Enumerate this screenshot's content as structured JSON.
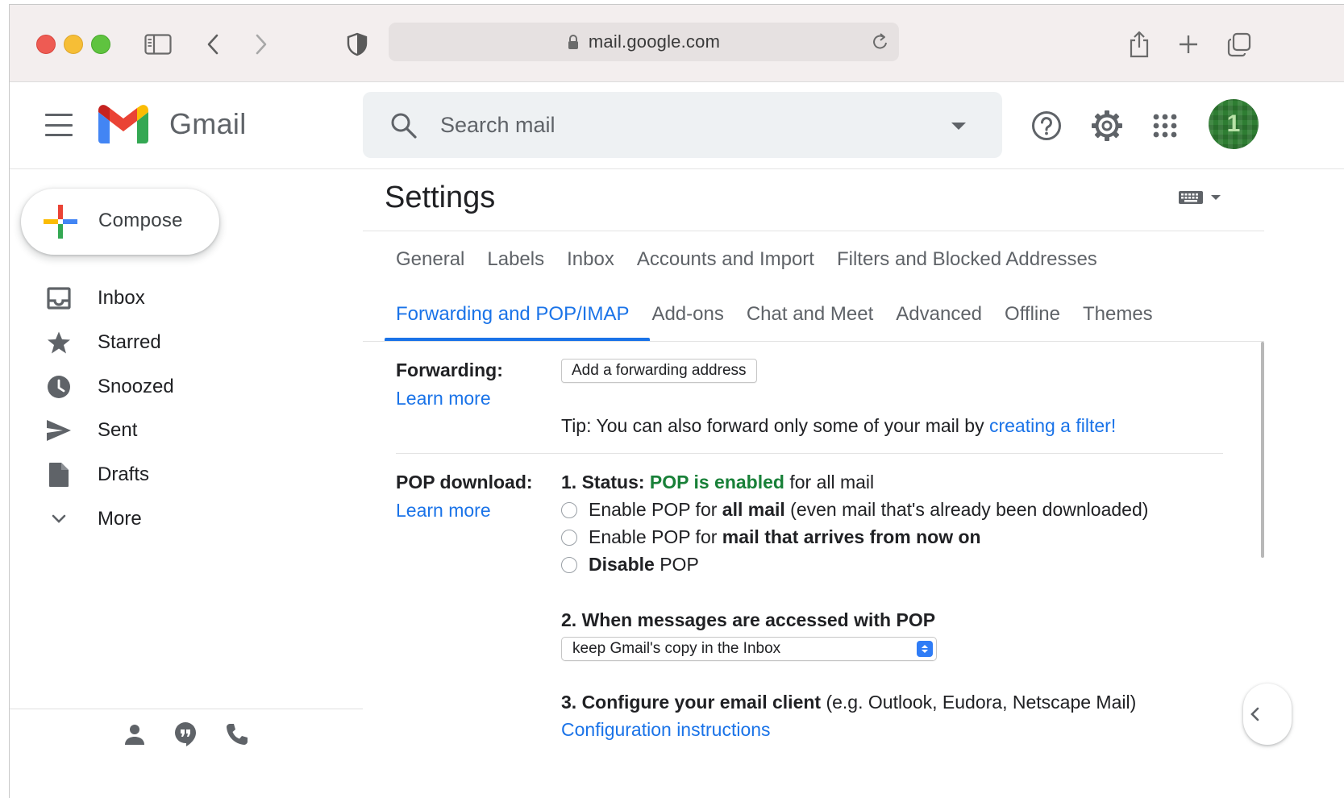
{
  "browser": {
    "url": "mail.google.com"
  },
  "header": {
    "app_name": "Gmail",
    "search_placeholder": "Search mail",
    "avatar_initial": "1"
  },
  "sidebar": {
    "compose_label": "Compose",
    "items": [
      {
        "label": "Inbox",
        "icon": "inbox-icon"
      },
      {
        "label": "Starred",
        "icon": "star-icon"
      },
      {
        "label": "Snoozed",
        "icon": "clock-icon"
      },
      {
        "label": "Sent",
        "icon": "send-icon"
      },
      {
        "label": "Drafts",
        "icon": "draft-icon"
      },
      {
        "label": "More",
        "icon": "chevron-down-icon"
      }
    ]
  },
  "settings": {
    "title": "Settings",
    "tabs_row1": [
      "General",
      "Labels",
      "Inbox",
      "Accounts and Import",
      "Filters and Blocked Addresses"
    ],
    "tabs_row2": [
      "Forwarding and POP/IMAP",
      "Add-ons",
      "Chat and Meet",
      "Advanced",
      "Offline",
      "Themes"
    ],
    "active_tab": "Forwarding and POP/IMAP",
    "forwarding": {
      "label": "Forwarding:",
      "learn_more": "Learn more",
      "button": "Add a forwarding address",
      "tip_prefix": "Tip: You can also forward only some of your mail by ",
      "tip_link": "creating a filter!"
    },
    "pop": {
      "label": "POP download:",
      "learn_more": "Learn more",
      "status_prefix": "1. Status: ",
      "status_value": "POP is enabled",
      "status_suffix": " for all mail",
      "options": [
        {
          "pre": "Enable POP for ",
          "bold": "all mail",
          "post": " (even mail that's already been downloaded)"
        },
        {
          "pre": "Enable POP for ",
          "bold": "mail that arrives from now on",
          "post": ""
        },
        {
          "pre": "",
          "bold": "Disable",
          "post": " POP"
        }
      ],
      "access_heading": "2. When messages are accessed with POP",
      "access_selected": "keep Gmail's copy in the Inbox",
      "client_heading": "3. Configure your email client",
      "client_note": " (e.g. Outlook, Eudora, Netscape Mail)",
      "client_link": "Configuration instructions"
    }
  }
}
